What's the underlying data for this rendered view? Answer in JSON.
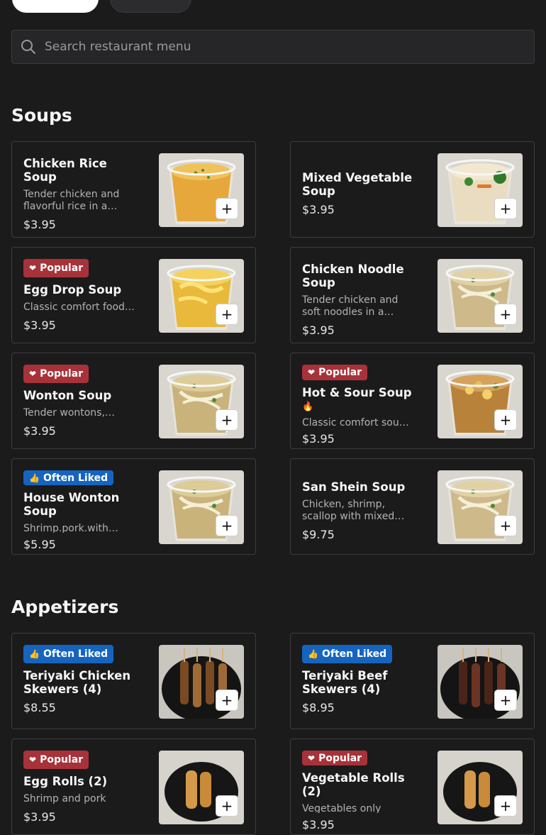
{
  "search": {
    "placeholder": "Search restaurant menu"
  },
  "sections": [
    {
      "title": "Soups",
      "items": [
        {
          "name": "Chicken Rice Soup",
          "badge": "",
          "badge_type": "",
          "desc": "Tender chicken and flavorful rice in a…",
          "price": "$3.95",
          "spicy": false,
          "image": "soup-clear"
        },
        {
          "name": "Mixed Vegetable Soup",
          "badge": "",
          "badge_type": "",
          "desc": "",
          "price": "$3.95",
          "spicy": false,
          "image": "soup-veg"
        },
        {
          "name": "Egg Drop Soup",
          "badge": "Popular",
          "badge_type": "popular",
          "desc": "Classic comfort food…",
          "price": "$3.95",
          "spicy": false,
          "image": "soup-egg"
        },
        {
          "name": "Chicken Noodle Soup",
          "badge": "",
          "badge_type": "",
          "desc": "Tender chicken and soft noodles in a…",
          "price": "$3.95",
          "spicy": false,
          "image": "soup-noodle"
        },
        {
          "name": "Wonton Soup",
          "badge": "Popular",
          "badge_type": "popular",
          "desc": "Tender wontons,…",
          "price": "$3.95",
          "spicy": false,
          "image": "soup-wonton"
        },
        {
          "name": "Hot & Sour Soup",
          "badge": "Popular",
          "badge_type": "popular",
          "desc": "Classic comfort sou…",
          "price": "$3.95",
          "spicy": true,
          "image": "soup-hotsour"
        },
        {
          "name": "House Wonton Soup",
          "badge": "Often Liked",
          "badge_type": "liked",
          "desc": "Shrimp.pork.with…",
          "price": "$5.95",
          "spicy": false,
          "image": "soup-wonton"
        },
        {
          "name": "San Shein Soup",
          "badge": "",
          "badge_type": "",
          "desc": "Chicken, shrimp, scallop with mixed…",
          "price": "$9.75",
          "spicy": false,
          "image": "soup-noodle"
        }
      ]
    },
    {
      "title": "Appetizers",
      "items": [
        {
          "name": "Teriyaki Chicken Skewers (4)",
          "badge": "Often Liked",
          "badge_type": "liked",
          "desc": "",
          "price": "$8.55",
          "spicy": false,
          "image": "skewer-chicken"
        },
        {
          "name": "Teriyaki Beef Skewers (4)",
          "badge": "Often Liked",
          "badge_type": "liked",
          "desc": "",
          "price": "$8.95",
          "spicy": false,
          "image": "skewer-beef"
        },
        {
          "name": "Egg Rolls (2)",
          "badge": "Popular",
          "badge_type": "popular",
          "desc": "Shrimp and pork",
          "price": "$3.95",
          "spicy": false,
          "image": "rolls"
        },
        {
          "name": "Vegetable Rolls (2)",
          "badge": "Popular",
          "badge_type": "popular",
          "desc": "Vegetables only",
          "price": "$3.95",
          "spicy": false,
          "image": "rolls"
        }
      ]
    }
  ],
  "colors": {
    "popular_badge": "#a8323a",
    "liked_badge": "#1565c0",
    "background": "#1b1b1c"
  },
  "icons": {
    "search": "search-icon",
    "add": "plus-icon",
    "popular": "heart-icon",
    "liked": "thumbs-up-icon",
    "spicy": "flame-icon"
  },
  "add_label": "+"
}
